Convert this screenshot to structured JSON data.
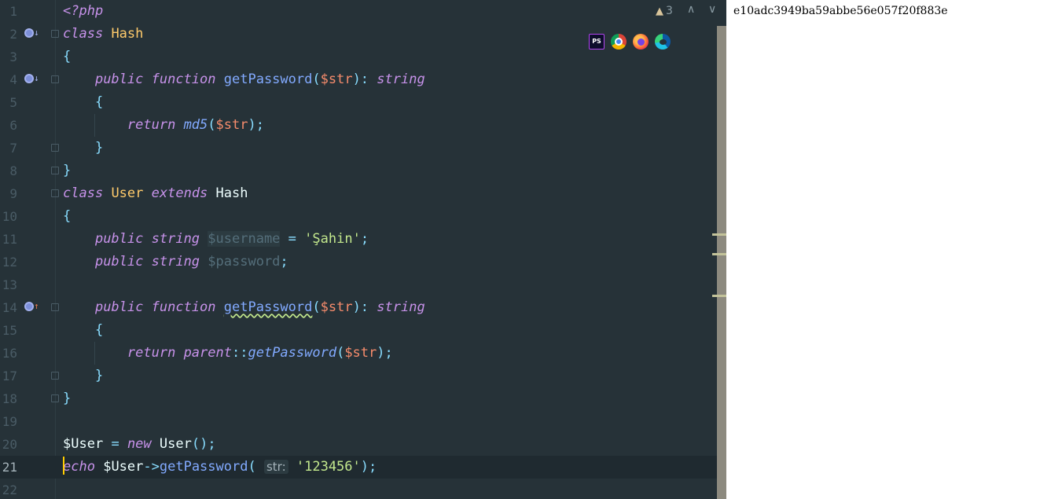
{
  "editor": {
    "warnings": {
      "icon": "warning-triangle-icon",
      "count": "3"
    },
    "browsers": [
      "phpstorm-icon",
      "chrome-icon",
      "firefox-icon",
      "edge-icon"
    ],
    "lines": [
      {
        "num": "1"
      },
      {
        "num": "2"
      },
      {
        "num": "3"
      },
      {
        "num": "4"
      },
      {
        "num": "5"
      },
      {
        "num": "6"
      },
      {
        "num": "7"
      },
      {
        "num": "8"
      },
      {
        "num": "9"
      },
      {
        "num": "10"
      },
      {
        "num": "11"
      },
      {
        "num": "12"
      },
      {
        "num": "13"
      },
      {
        "num": "14"
      },
      {
        "num": "15"
      },
      {
        "num": "16"
      },
      {
        "num": "17"
      },
      {
        "num": "18"
      },
      {
        "num": "19"
      },
      {
        "num": "20"
      },
      {
        "num": "21"
      },
      {
        "num": "22"
      }
    ],
    "tokens": {
      "l1": "<?php",
      "l2_kw": "class",
      "l2_cls": "Hash",
      "l3": "{",
      "l4_kw1": "public",
      "l4_kw2": "function",
      "l4_fn": "getPassword",
      "l4_p1": "(",
      "l4_var": "$str",
      "l4_p2": "):",
      "l4_type": "string",
      "l5": "{",
      "l6_kw": "return",
      "l6_fn": "md5",
      "l6_p1": "(",
      "l6_var": "$str",
      "l6_p2": ");",
      "l7": "}",
      "l8": "}",
      "l9_kw": "class",
      "l9_cls": "User",
      "l9_kw2": "extends",
      "l9_cls2": "Hash",
      "l10": "{",
      "l11_kw1": "public",
      "l11_type": "string",
      "l11_var": "$username",
      "l11_eq": "=",
      "l11_str": "'Şahin'",
      "l11_semi": ";",
      "l12_kw1": "public",
      "l12_type": "string",
      "l12_var": "$password",
      "l12_semi": ";",
      "l14_kw1": "public",
      "l14_kw2": "function",
      "l14_fn": "getPassword",
      "l14_p1": "(",
      "l14_var": "$str",
      "l14_p2": "):",
      "l14_type": "string",
      "l15": "{",
      "l16_kw": "return",
      "l16_kw2": "parent",
      "l16_sep": "::",
      "l16_fn": "getPassword",
      "l16_p1": "(",
      "l16_var": "$str",
      "l16_p2": ");",
      "l17": "}",
      "l18": "}",
      "l20_var": "$User",
      "l20_eq": "=",
      "l20_kw": "new",
      "l20_cls": "User",
      "l20_p": "();",
      "l21_kw": "echo",
      "l21_var": "$User",
      "l21_arrow": "->",
      "l21_fn": "getPassword",
      "l21_p1": "(",
      "l21_hint": "str:",
      "l21_str": "'123456'",
      "l21_p2": ");"
    }
  },
  "output": {
    "text": "e10adc3949ba59abbe56e057f20f883e"
  }
}
